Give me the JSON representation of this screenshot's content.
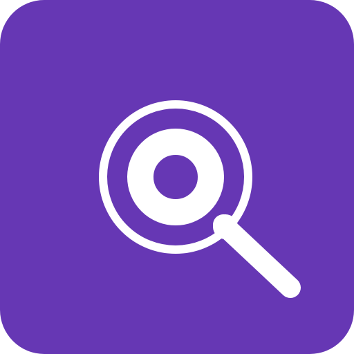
{
  "icon": {
    "name": "search-icon",
    "background_color": "#6637b4",
    "glyph_color": "#ffffff"
  }
}
